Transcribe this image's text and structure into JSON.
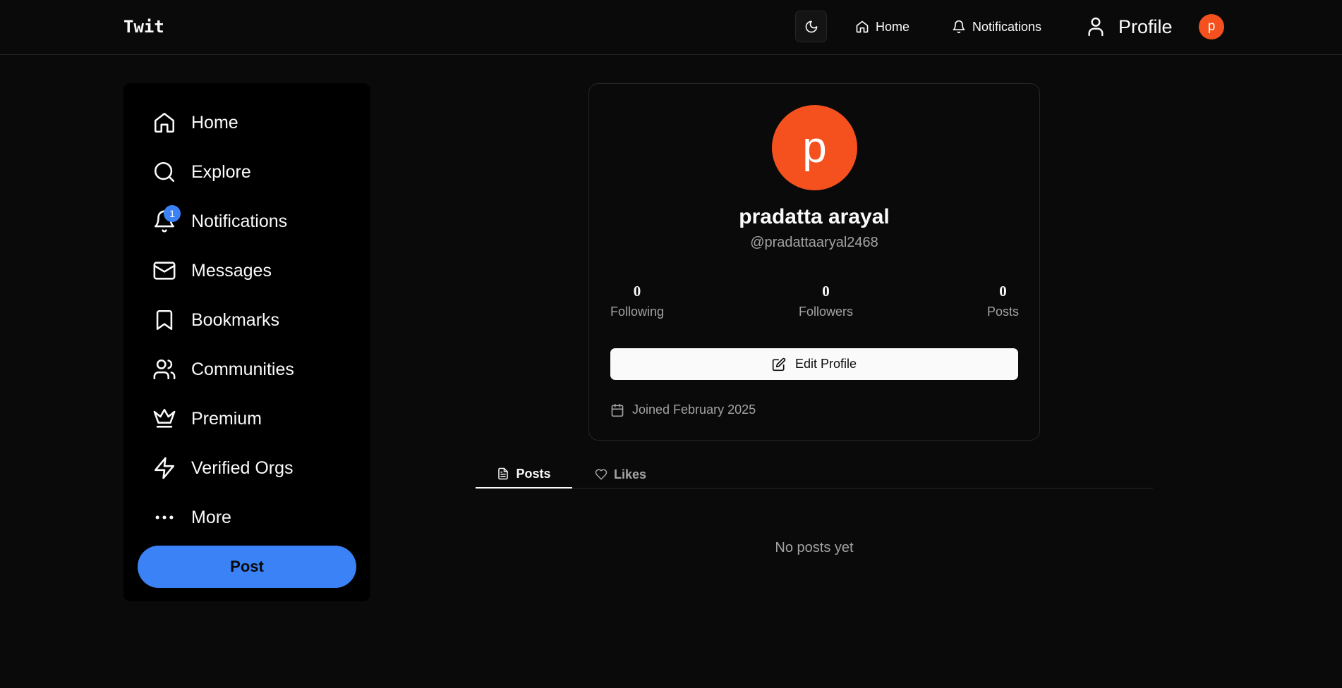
{
  "app": {
    "brand": "Twit"
  },
  "topbar": {
    "theme_toggle_icon": "moon-icon",
    "nav": [
      {
        "label": "Home",
        "icon": "home-icon"
      },
      {
        "label": "Notifications",
        "icon": "bell-icon"
      },
      {
        "label": "Profile",
        "icon": "user-icon"
      }
    ],
    "avatar_initial": "p"
  },
  "sidebar": {
    "items": [
      {
        "label": "Home",
        "icon": "home-icon"
      },
      {
        "label": "Explore",
        "icon": "search-icon"
      },
      {
        "label": "Notifications",
        "icon": "bell-icon",
        "badge": "1"
      },
      {
        "label": "Messages",
        "icon": "mail-icon"
      },
      {
        "label": "Bookmarks",
        "icon": "bookmark-icon"
      },
      {
        "label": "Communities",
        "icon": "users-icon"
      },
      {
        "label": "Premium",
        "icon": "crown-icon"
      },
      {
        "label": "Verified Orgs",
        "icon": "lightning-icon"
      },
      {
        "label": "More",
        "icon": "more-icon"
      }
    ],
    "post_label": "Post"
  },
  "profile": {
    "avatar_initial": "p",
    "name": "pradatta arayal",
    "handle": "@pradattaaryal2468",
    "stats": {
      "following": {
        "value": "0",
        "label": "Following"
      },
      "followers": {
        "value": "0",
        "label": "Followers"
      },
      "posts": {
        "value": "0",
        "label": "Posts"
      }
    },
    "edit_label": "Edit Profile",
    "joined": "Joined February 2025"
  },
  "tabs": [
    {
      "label": "Posts",
      "icon": "file-text-icon",
      "active": true
    },
    {
      "label": "Likes",
      "icon": "heart-icon",
      "active": false
    }
  ],
  "empty_state": "No posts yet",
  "colors": {
    "background": "#0a0a0a",
    "sidebar": "#000000",
    "accent": "#3b82f6",
    "avatar": "#f4511e",
    "muted_text": "#a3a3a3"
  }
}
